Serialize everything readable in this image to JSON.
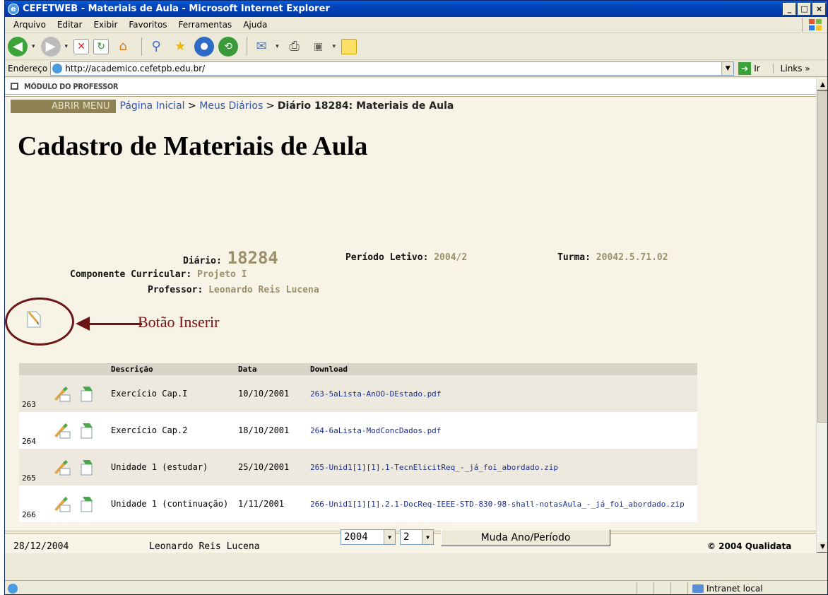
{
  "window": {
    "title": "CEFETWEB - Materiais de Aula - Microsoft Internet Explorer",
    "min": "_",
    "max": "□",
    "close": "×"
  },
  "menu": [
    "Arquivo",
    "Editar",
    "Exibir",
    "Favoritos",
    "Ferramentas",
    "Ajuda"
  ],
  "address": {
    "label": "Endereço",
    "url": "http://academico.cefetpb.edu.br/",
    "go": "Ir",
    "links": "Links »"
  },
  "page": {
    "module": "MÓDULO DO PROFESSOR",
    "abrir_menu": "ABRIR MENU",
    "breadcrumb": {
      "home": "Página Inicial",
      "sep1": " > ",
      "diarios": "Meus Diários",
      "sep2": " > ",
      "current": "Diário 18284: Materiais de Aula"
    },
    "title": "Cadastro de Materiais de Aula",
    "info": {
      "diario_label": "Diário:",
      "diario": "18284",
      "periodo_label": "Período Letivo:",
      "periodo": "2004/2",
      "turma_label": "Turma:",
      "turma": "20042.5.71.02",
      "componente_label": "Componente Curricular:",
      "componente": "Projeto I",
      "professor_label": "Professor:",
      "professor": "Leonardo Reis Lucena"
    },
    "annotation": "Botão Inserir",
    "table": {
      "headers": [
        "Descrição",
        "Data",
        "Download"
      ],
      "rows": [
        {
          "id": "263",
          "desc": "Exercício Cap.I",
          "date": "10/10/2001",
          "file": "263-5aLista-AnOO-DEstado.pdf"
        },
        {
          "id": "264",
          "desc": "Exercício Cap.2",
          "date": "18/10/2001",
          "file": "264-6aLista-ModConcDados.pdf"
        },
        {
          "id": "265",
          "desc": "Unidade 1 (estudar)",
          "date": "25/10/2001",
          "file": "265-Unid1[1][1].1-TecnElicitReq_-_já_foi_abordado.zip"
        },
        {
          "id": "266",
          "desc": "Unidade 1 (continuação)",
          "date": "1/11/2001",
          "file": "266-Unid1[1][1].2.1-DocReq-IEEE-STD-830-98-shall-notasAula_-_já_foi_abordado.zip"
        }
      ]
    },
    "footer": {
      "date": "28/12/2004",
      "user": "Leonardo Reis Lucena",
      "year": "2004",
      "period": "2",
      "button": "Muda Ano/Período",
      "copyright": "© 2004 Qualidata"
    }
  },
  "status": {
    "zone": "Intranet local"
  }
}
